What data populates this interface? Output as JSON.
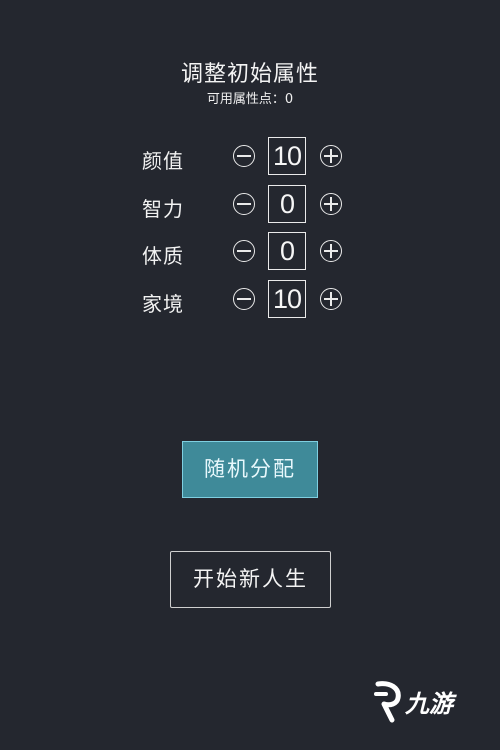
{
  "header": {
    "title": "调整初始属性",
    "points_text": "可用属性点：0"
  },
  "attributes": [
    {
      "label": "颜值",
      "value": "10"
    },
    {
      "label": "智力",
      "value": "0"
    },
    {
      "label": "体质",
      "value": "0"
    },
    {
      "label": "家境",
      "value": "10"
    }
  ],
  "buttons": {
    "random_label": "随机分配",
    "start_label": "开始新人生"
  },
  "watermark": {
    "text": "九游"
  },
  "colors": {
    "background": "#24272f",
    "random_button": "#3f8a99",
    "random_button_border": "#7fcfe0"
  }
}
